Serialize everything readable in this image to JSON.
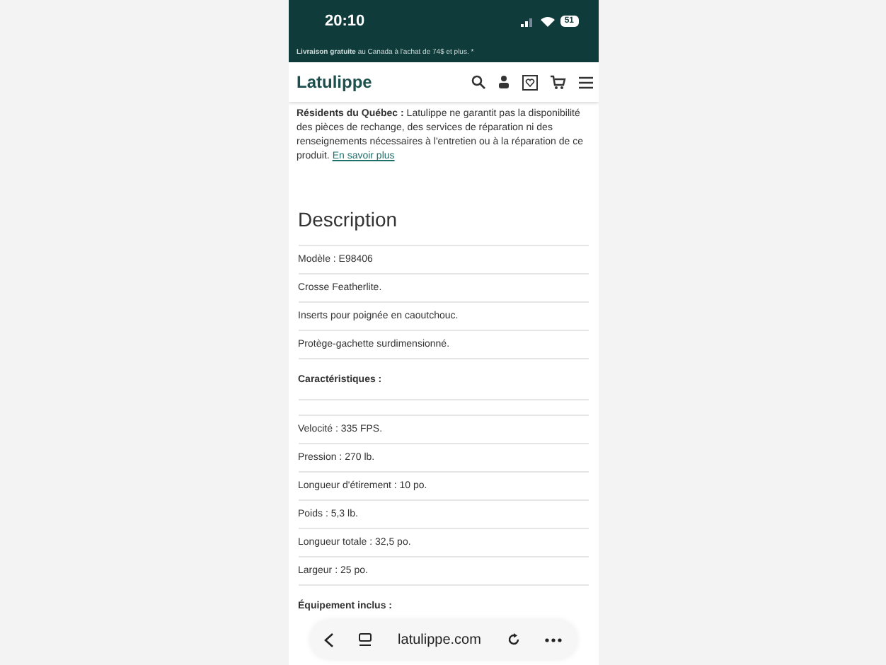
{
  "status_bar": {
    "time": "20:10",
    "battery": "51"
  },
  "promo": {
    "bold": "Livraison gratuite",
    "text": "au Canada à l'achat de 74$ et plus. *"
  },
  "header": {
    "logo": "Latulippe"
  },
  "notice": {
    "text": "**Résidents du Québec :** Latulippe ne garantit pas la disponibilité des pièces de rechange, des services de réparation ni des renseignements nécessaires à l'entretien ou à la réparation de ce produit.",
    "link": "En savoir plus"
  },
  "description": {
    "title": "Description",
    "rows": [
      {
        "kind": "item",
        "text": "Modèle : E98406"
      },
      {
        "kind": "item",
        "text": "Crosse Featherlite."
      },
      {
        "kind": "item",
        "text": "Inserts pour poignée en caoutchouc."
      },
      {
        "kind": "item",
        "text": "Protège-gachette surdimensionné."
      },
      {
        "kind": "heading",
        "text": "Caractéristiques :"
      },
      {
        "kind": "blank",
        "text": ""
      },
      {
        "kind": "item",
        "text": "Velocité : 335 FPS."
      },
      {
        "kind": "item",
        "text": "Pression : 270 lb."
      },
      {
        "kind": "item",
        "text": "Longueur d'étirement : 10 po."
      },
      {
        "kind": "item",
        "text": "Poids : 5,3 lb."
      },
      {
        "kind": "item",
        "text": "Longueur totale : 32,5 po."
      },
      {
        "kind": "item",
        "text": "Largeur : 25 po."
      },
      {
        "kind": "heading",
        "text": "Équipement inclus :"
      }
    ]
  },
  "browser_bar": {
    "url": "latulippe.com"
  }
}
